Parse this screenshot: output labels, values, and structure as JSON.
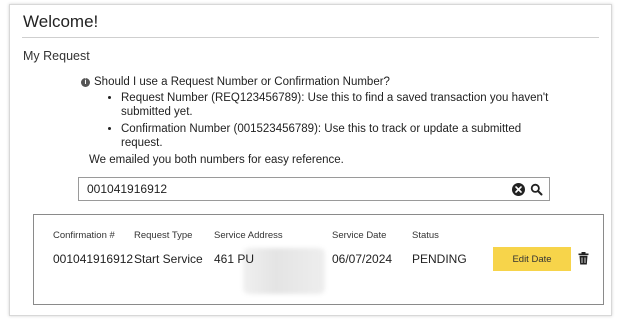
{
  "page": {
    "title": "Welcome!",
    "section_title": "My Request"
  },
  "info": {
    "icon": "info-icon",
    "question": "Should I use a Request Number or Confirmation Number?",
    "bullets": [
      "Request Number (REQ123456789): Use this to find a saved transaction you haven't submitted yet.",
      "Confirmation Number (001523456789): Use this to track or update a submitted request."
    ],
    "note": "We emailed you both numbers for easy reference."
  },
  "search": {
    "value": "001041916912",
    "clear_icon": "clear-circle-icon",
    "search_icon": "search-icon"
  },
  "results": {
    "headers": [
      "Confirmation #",
      "Request Type",
      "Service Address",
      "Service Date",
      "Status"
    ],
    "row": {
      "confirmation": "001041916912",
      "request_type": "Start Service",
      "service_address": "461 PU",
      "service_date": "06/07/2024",
      "status": "PENDING",
      "action_label": "Edit Date",
      "delete_icon": "trash-icon"
    }
  },
  "colors": {
    "accent_button": "#f7d44a",
    "border": "#8a8a8a"
  }
}
